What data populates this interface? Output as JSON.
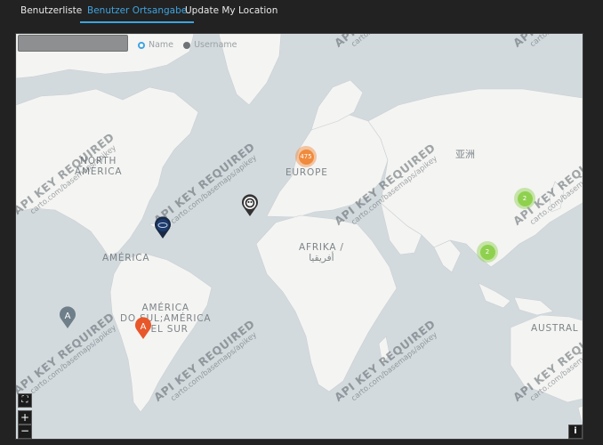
{
  "tabs": [
    {
      "label": "Benutzerliste",
      "active": false
    },
    {
      "label": "Benutzer Ortsangabe",
      "active": true
    },
    {
      "label": "Update My Location",
      "active": false
    }
  ],
  "search": {
    "value": "",
    "placeholder": ""
  },
  "radios": [
    {
      "label": "Name",
      "checked": true
    },
    {
      "label": "Username",
      "checked": false
    }
  ],
  "map_labels": {
    "north_america_1": "NORTH",
    "north_america_2": "AMERICA",
    "europe": "EUROPE",
    "asia": "亚洲",
    "africa_1": "AFRIKA /",
    "africa_2": "أفريقيا",
    "america": "AMÉRICA",
    "south_america_1": "AMÉRICA",
    "south_america_2": "DO SUL;AMÉRICA",
    "south_america_3": "DEL SUR",
    "australia": "AUSTRAL"
  },
  "watermark": {
    "title": "API KEY REQUIRED",
    "subtitle": "carto.com/basemaps/apikey"
  },
  "clusters": [
    {
      "count": "475",
      "color": "#f08a3c"
    },
    {
      "count": "2",
      "color": "#8fd14f"
    },
    {
      "count": "2",
      "color": "#8fd14f"
    }
  ],
  "markers": [
    {
      "letter": "A",
      "color": "#e8572a"
    },
    {
      "letter": "A",
      "color": "#6e7f8a"
    }
  ],
  "controls": {
    "fullscreen": "⛶",
    "zoom_in": "+",
    "zoom_out": "−",
    "info": "i"
  }
}
